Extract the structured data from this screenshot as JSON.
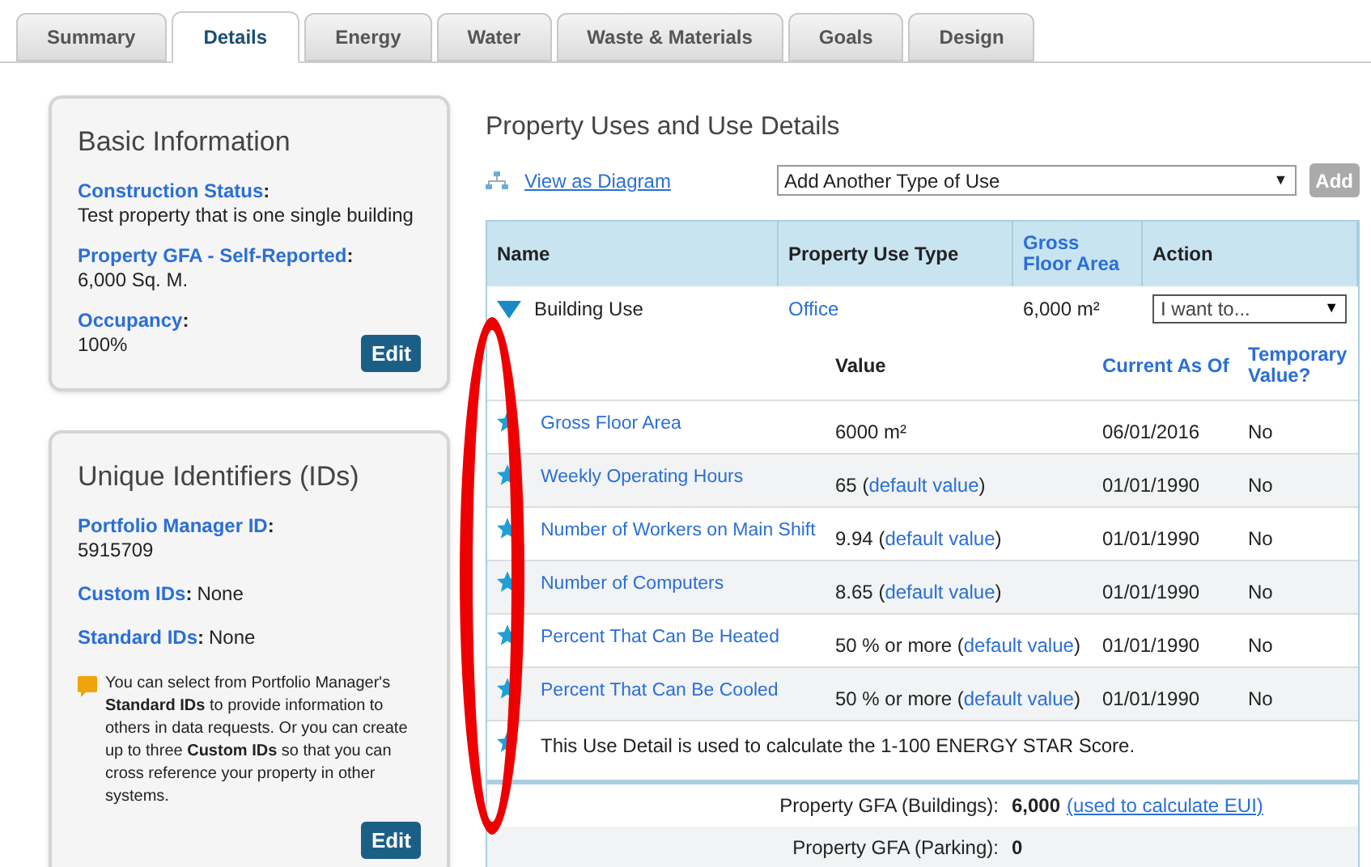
{
  "tabs": [
    {
      "label": "Summary",
      "selected": false
    },
    {
      "label": "Details",
      "selected": true
    },
    {
      "label": "Energy",
      "selected": false
    },
    {
      "label": "Water",
      "selected": false
    },
    {
      "label": "Waste & Materials",
      "selected": false
    },
    {
      "label": "Goals",
      "selected": false
    },
    {
      "label": "Design",
      "selected": false
    }
  ],
  "basic_information": {
    "title": "Basic Information",
    "fields": [
      {
        "label": "Construction Status",
        "separator": ":",
        "value": "Test property that is one single building"
      },
      {
        "label": "Property GFA - Self-Reported",
        "separator": ":",
        "value": "6,000 Sq. M."
      },
      {
        "label": "Occupancy",
        "separator": ":",
        "value": "100%"
      }
    ],
    "button": "Edit"
  },
  "unique_identifiers": {
    "title": "Unique Identifiers (IDs)",
    "fields": [
      {
        "label": "Portfolio Manager ID",
        "separator": ":",
        "value": "5915709",
        "inline": false
      },
      {
        "label": "Custom IDs",
        "separator": ":",
        "value": "None",
        "inline": true
      },
      {
        "label": "Standard IDs",
        "separator": ":",
        "value": "None",
        "inline": true
      }
    ],
    "note": "You can select from Portfolio Manager's **Standard IDs** to provide information to others in data requests. Or you can create up to three **Custom IDs** so that you can cross reference your property in other systems.",
    "button": "Edit"
  },
  "property_uses": {
    "title": "Property Uses and Use Details",
    "view_link": "View as Diagram",
    "add_select": "Add Another Type of Use",
    "add_select_arrow": "▼",
    "add_button": "Add",
    "columns": [
      "Name",
      "Property Use Type",
      "Gross Floor Area",
      "Action"
    ],
    "use": {
      "name": "Building Use",
      "expanded": true,
      "type": "Office",
      "gfa": "6,000 m²",
      "action": "I want to...",
      "action_arrow": "▼"
    },
    "detail_columns": [
      "Value",
      "Current As Of",
      "Temporary Value?"
    ],
    "details": [
      {
        "name": "Gross Floor Area",
        "value": "6000 m²",
        "date": "06/01/2016",
        "temporary": "No"
      },
      {
        "name": "Weekly Operating Hours",
        "value": "65",
        "open": "(",
        "default_link": "default value",
        "close": ")",
        "date": "01/01/1990",
        "temporary": "No"
      },
      {
        "name": "Number of Workers on Main Shift",
        "value": "9.94",
        "open": "(",
        "default_link": "default value",
        "close": ")",
        "date": "01/01/1990",
        "temporary": "No"
      },
      {
        "name": "Number of Computers",
        "value": "8.65",
        "open": "(",
        "default_link": "default value",
        "close": ")",
        "date": "01/01/1990",
        "temporary": "No"
      },
      {
        "name": "Percent That Can Be Heated",
        "value": "50 % or more",
        "open": "(",
        "default_link": "default value",
        "close": ")",
        "date": "01/01/1990",
        "temporary": "No"
      },
      {
        "name": "Percent That Can Be Cooled",
        "value": "50 % or more",
        "open": "(",
        "default_link": "default value",
        "close": ")",
        "date": "01/01/1990",
        "temporary": "No"
      }
    ],
    "star_note": "This Use Detail is used to calculate the 1-100 ENERGY STAR Score.",
    "totals": [
      {
        "label": "Property GFA (Buildings):",
        "value": "6,000",
        "link": "(used to calculate EUI)"
      },
      {
        "label": "Property GFA (Parking):",
        "value": "0"
      }
    ]
  }
}
